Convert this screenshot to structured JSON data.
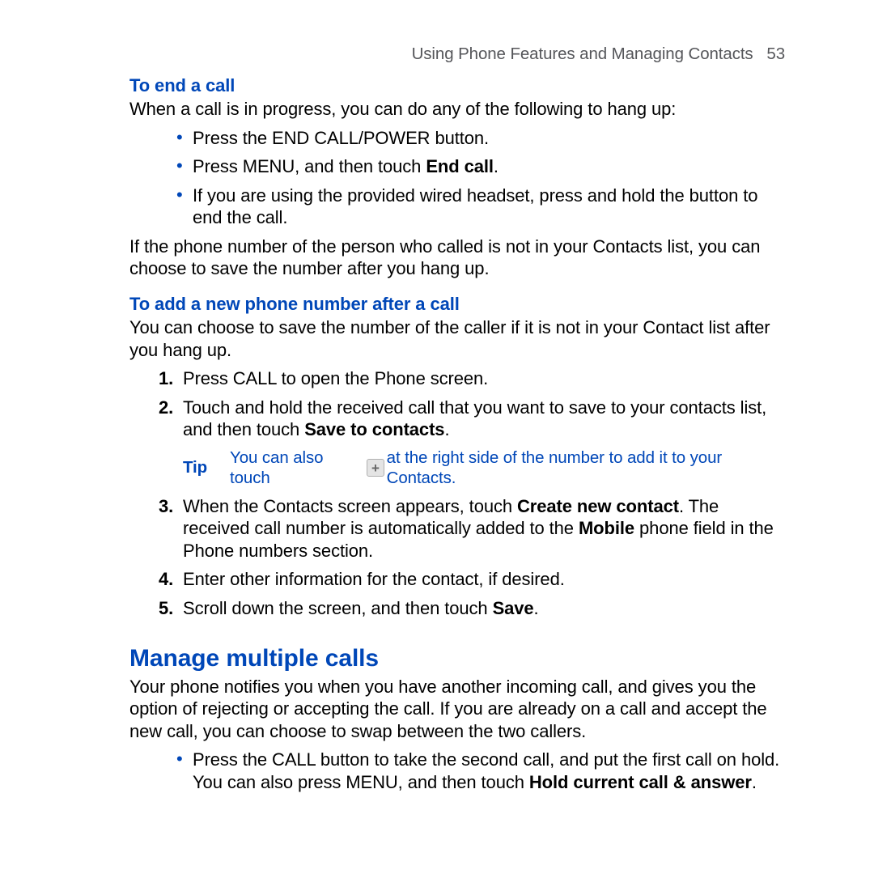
{
  "header": {
    "title": "Using Phone Features and Managing Contacts",
    "page": "53"
  },
  "sec1": {
    "heading": "To end a call",
    "intro": "When a call is in progress, you can do any of the following to hang up:",
    "b1": "Press the END CALL/POWER button.",
    "b2_a": "Press MENU, and then touch ",
    "b2_b": "End call",
    "b2_c": ".",
    "b3": "If you are using the provided wired headset, press and hold the button to end the call.",
    "after": "If the phone number of the person who called is not in your Contacts list, you can choose to save the number after you hang up."
  },
  "sec2": {
    "heading": "To add a new phone number after a call",
    "intro": "You can choose to save the number of the caller if it is not in your Contact list after you hang up.",
    "s1": "Press CALL to open the Phone screen.",
    "s2_a": "Touch and hold the received call that you want to save to your contacts list, and then touch ",
    "s2_b": "Save to contacts",
    "s2_c": ".",
    "tip_label": "Tip",
    "tip_a": "You can also touch ",
    "tip_b": " at the right side of the number to add it to your Contacts.",
    "s3_a": "When the Contacts screen appears, touch ",
    "s3_b": "Create new contact",
    "s3_c": ". The received call number is automatically added to the ",
    "s3_d": "Mobile",
    "s3_e": " phone field in the Phone numbers section.",
    "s4": "Enter other information for the contact, if desired.",
    "s5_a": "Scroll down the screen, and then touch ",
    "s5_b": "Save",
    "s5_c": "."
  },
  "sec3": {
    "heading": "Manage multiple calls",
    "intro": "Your phone notifies you when you have another incoming call, and gives you the option of rejecting or accepting the call. If you are already on a call and accept the new call, you can choose to swap between the two callers.",
    "b1_a": "Press the CALL button to take the second call, and put the first call on hold. You can also press MENU, and then touch ",
    "b1_b": "Hold current call & answer",
    "b1_c": "."
  }
}
